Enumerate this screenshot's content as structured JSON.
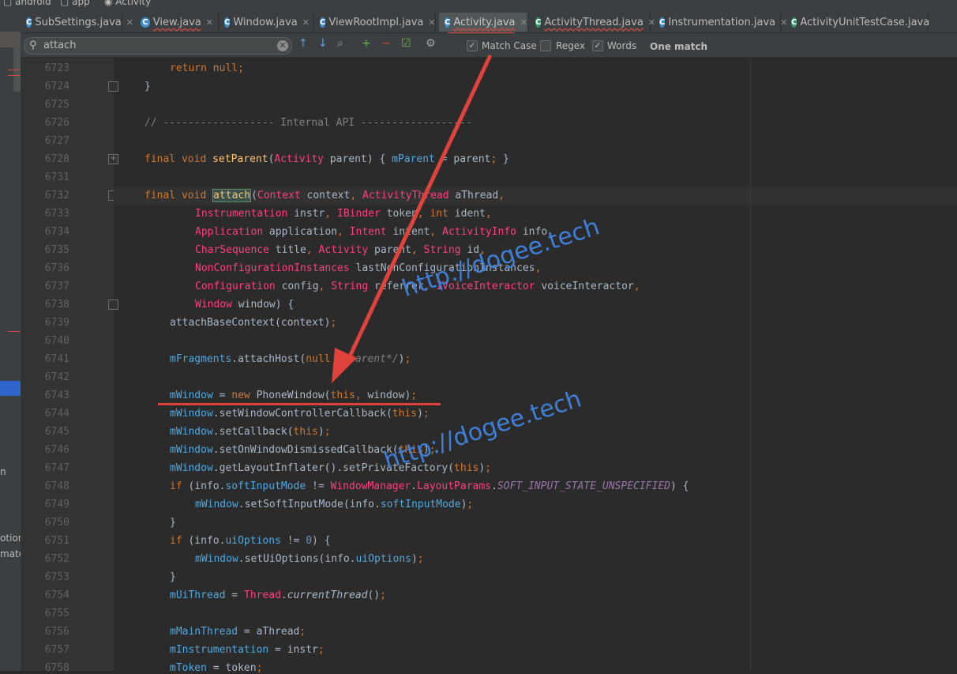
{
  "breadcrumb": [
    "android",
    "app",
    "Activity"
  ],
  "tabs": [
    {
      "label": "SubSettings.java",
      "icon": "C"
    },
    {
      "label": "View.java",
      "icon": "C"
    },
    {
      "label": "Window.java",
      "icon": "C"
    },
    {
      "label": "ViewRootImpl.java",
      "icon": "C"
    },
    {
      "label": "Activity.java",
      "icon": "C"
    },
    {
      "label": "ActivityThread.java",
      "icon": "C"
    },
    {
      "label": "Instrumentation.java",
      "icon": "C"
    },
    {
      "label": "ActivityUnitTestCase.java",
      "icon": "C"
    }
  ],
  "find": {
    "query": "attach",
    "match_case_label": "Match Case",
    "regex_label": "Regex",
    "words_label": "Words",
    "result": "One match",
    "match_case": true,
    "regex": false,
    "words": true
  },
  "line_numbers": [
    "6723",
    "6724",
    "6725",
    "6726",
    "6727",
    "6728",
    "6731",
    "6732",
    "6733",
    "6734",
    "6735",
    "6736",
    "6737",
    "6738",
    "6739",
    "6740",
    "6741",
    "6742",
    "6743",
    "6744",
    "6745",
    "6746",
    "6747",
    "6748",
    "6749",
    "6750",
    "6751",
    "6752",
    "6753",
    "6754",
    "6755",
    "6756",
    "6757",
    "6758"
  ],
  "code": {
    "l6723": "return null;",
    "l6724": "}",
    "l6726": "// ------------------ Internal API ------------------",
    "l6728": "final void setParent(Activity parent) { mParent = parent; }",
    "l6732": "final void attach(Context context, ActivityThread aThread,",
    "l6733": "Instrumentation instr, IBinder token, int ident,",
    "l6734": "Application application, Intent intent, ActivityInfo info,",
    "l6735": "CharSequence title, Activity parent, String id,",
    "l6736": "NonConfigurationInstances lastNonConfigurationInstances,",
    "l6737": "Configuration config, String referrer, IVoiceInteractor voiceInteractor,",
    "l6738": "Window window) {",
    "l6739": "attachBaseContext(context);",
    "l6741": "mFragments.attachHost(null /*parent*/);",
    "l6743": "mWindow = new PhoneWindow(this, window);",
    "l6744": "mWindow.setWindowControllerCallback(this);",
    "l6745": "mWindow.setCallback(this);",
    "l6746": "mWindow.setOnWindowDismissedCallback(this);",
    "l6747": "mWindow.getLayoutInflater().setPrivateFactory(this);",
    "l6748": "if (info.softInputMode != WindowManager.LayoutParams.SOFT_INPUT_STATE_UNSPECIFIED) {",
    "l6749": "mWindow.setSoftInputMode(info.softInputMode);",
    "l6750": "}",
    "l6751": "if (info.uiOptions != 0) {",
    "l6752": "mWindow.setUiOptions(info.uiOptions);",
    "l6753": "}",
    "l6754": "mUiThread = Thread.currentThread();",
    "l6756": "mMainThread = aThread;",
    "l6757": "mInstrumentation = instr;",
    "l6758": "mToken = token;"
  },
  "watermarks": [
    "http://dogee.tech",
    "http://dogee.tech"
  ],
  "left_panel_fragments": [
    "n",
    "otion",
    "mato"
  ],
  "colors": {
    "accent_red": "#e0433c",
    "watermark_blue": "#3f7fd8",
    "editor_bg": "#2b2b2b"
  }
}
